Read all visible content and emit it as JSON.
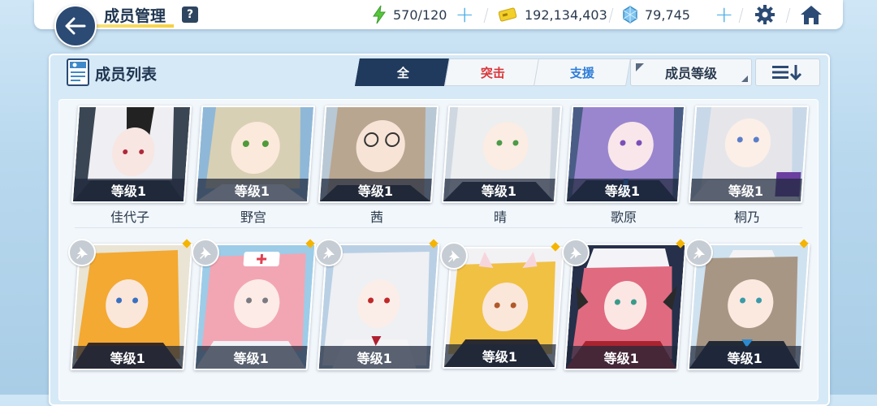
{
  "header": {
    "title": "成员管理",
    "help_label": "?",
    "ap": "570/120",
    "credits": "192,134,403",
    "pyroxene": "79,745",
    "icons": [
      "back-arrow-icon",
      "lightning-icon",
      "credit-card-icon",
      "pyroxene-crystal-icon",
      "gear-icon",
      "home-icon"
    ]
  },
  "list": {
    "title": "成员列表",
    "tabs": [
      "全",
      "突击",
      "支援"
    ],
    "sort_label": "成员等级",
    "order_icon": "sort-descending-icon"
  },
  "row1": [
    {
      "name": "佳代子",
      "level": "等级1"
    },
    {
      "name": "野宫",
      "level": "等级1"
    },
    {
      "name": "茜",
      "level": "等级1"
    },
    {
      "name": "晴",
      "level": "等级1"
    },
    {
      "name": "歌原",
      "level": "等级1"
    },
    {
      "name": "桐乃",
      "level": "等级1"
    }
  ],
  "row2": [
    {
      "level": "等级1"
    },
    {
      "level": "等级1"
    },
    {
      "level": "等级1"
    },
    {
      "level": "等级1"
    },
    {
      "level": "等级1"
    },
    {
      "level": "等级1"
    }
  ],
  "colors": {
    "navy": "#1f3a5c",
    "striker_red": "#d9363a",
    "special_blue": "#2f7ed8",
    "accent_yellow": "#f5b400",
    "ap_green": "#58c53c"
  }
}
